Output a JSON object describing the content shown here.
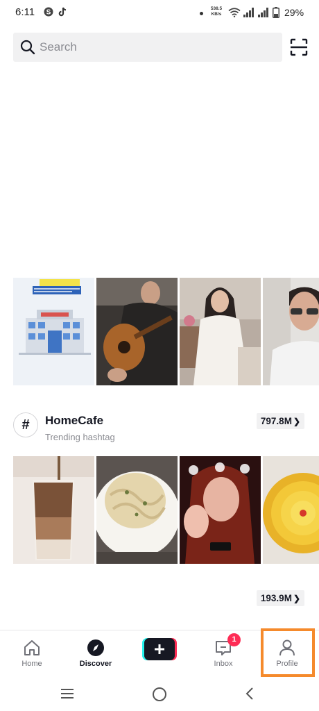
{
  "status_bar": {
    "time": "6:11",
    "app_icons": [
      "skype-icon",
      "tiktok-icon"
    ],
    "net_speed_value": "538.5",
    "net_speed_unit": "KB/s",
    "battery": "29%",
    "icons": [
      "wifi-icon",
      "signal-icon",
      "signal-icon",
      "battery-icon"
    ]
  },
  "search": {
    "placeholder": "Search",
    "scan_icon": "scan-icon"
  },
  "sections": [
    {
      "title": "",
      "subtitle": "",
      "count": "",
      "thumbnails": [
        "urdu-text-building-thumbnail",
        "man-playing-guitar-thumbnail",
        "woman-white-dress-thumbnail",
        "man-glasses-thumbnail"
      ]
    },
    {
      "title": "HomeCafe",
      "subtitle": "Trending hashtag",
      "count": "797.8M",
      "thumbnails": [
        "iced-coffee-thumbnail",
        "pasta-plate-thumbnail",
        "tiktok-girl-filter-thumbnail",
        "yellow-flower-tart-thumbnail"
      ]
    },
    {
      "title": "",
      "subtitle": "",
      "count": "193.9M",
      "thumbnails": []
    }
  ],
  "bottom_nav": {
    "items": [
      {
        "label": "Home",
        "icon": "home-icon",
        "active": false
      },
      {
        "label": "Discover",
        "icon": "compass-icon",
        "active": true
      },
      {
        "label": "",
        "icon": "plus-icon",
        "active": false
      },
      {
        "label": "Inbox",
        "icon": "inbox-icon",
        "active": false,
        "badge": "1"
      },
      {
        "label": "Profile",
        "icon": "profile-icon",
        "active": false
      }
    ],
    "highlight_color": "#f58a2c",
    "badge_color": "#fe2c55"
  },
  "android_nav": [
    "menu-icon",
    "home-circle-icon",
    "back-icon"
  ]
}
